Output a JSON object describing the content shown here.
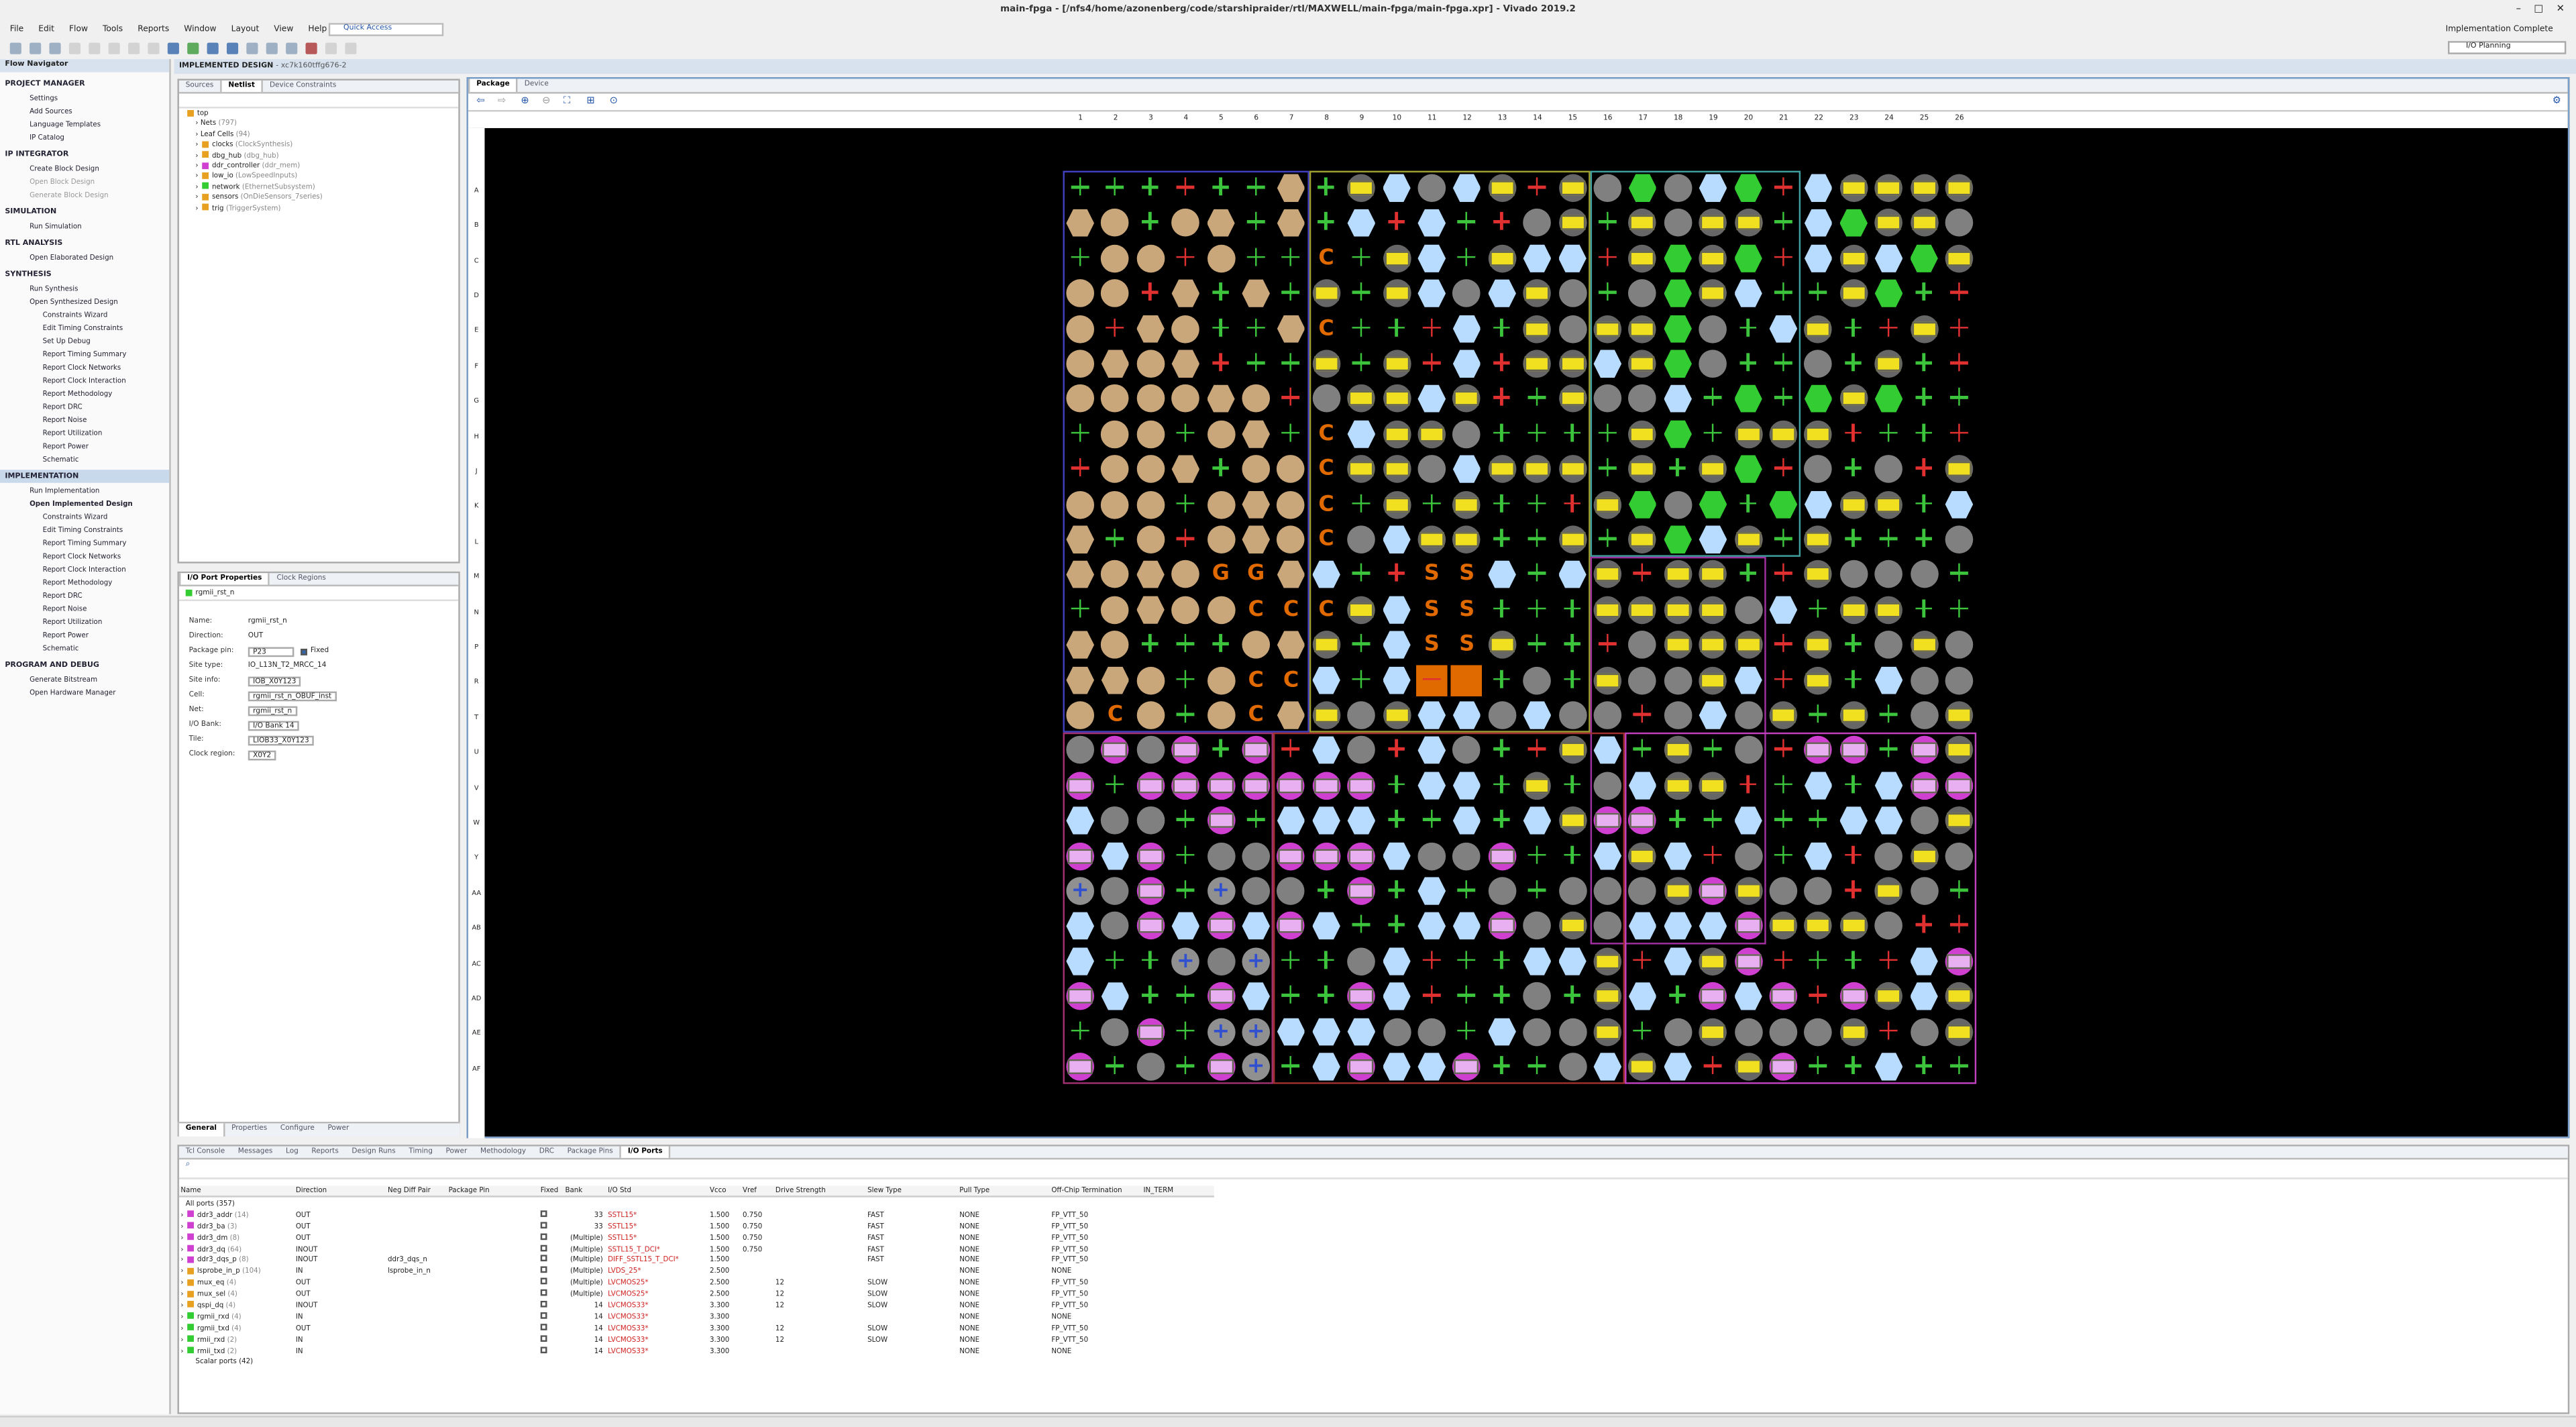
{
  "window": {
    "title": "main-fpga - [/nfs4/home/azonenberg/code/starshipraider/rtl/MAXWELL/main-fpga/main-fpga.xpr] - Vivado 2019.2"
  },
  "menu": [
    "File",
    "Edit",
    "Flow",
    "Tools",
    "Reports",
    "Window",
    "Layout",
    "View",
    "Help"
  ],
  "quick_access": "Quick Access",
  "status": {
    "implementation": "Implementation Complete",
    "layout": "I/O Planning"
  },
  "flow_navigator": {
    "title": "Flow Navigator",
    "project_manager": {
      "header": "PROJECT MANAGER",
      "items": [
        "Settings",
        "Add Sources",
        "Language Templates",
        "IP Catalog"
      ]
    },
    "ip_integrator": {
      "header": "IP INTEGRATOR",
      "items": [
        "Create Block Design",
        "Open Block Design",
        "Generate Block Design"
      ]
    },
    "simulation": {
      "header": "SIMULATION",
      "items": [
        "Run Simulation"
      ]
    },
    "rtl_analysis": {
      "header": "RTL ANALYSIS",
      "items": [
        "Open Elaborated Design"
      ]
    },
    "synthesis": {
      "header": "SYNTHESIS",
      "items": [
        "Run Synthesis",
        "Open Synthesized Design",
        "Constraints Wizard",
        "Edit Timing Constraints",
        "Set Up Debug",
        "Report Timing Summary",
        "Report Clock Networks",
        "Report Clock Interaction",
        "Report Methodology",
        "Report DRC",
        "Report Noise",
        "Report Utilization",
        "Report Power",
        "Schematic"
      ]
    },
    "implementation": {
      "header": "IMPLEMENTATION",
      "items": [
        "Run Implementation",
        "Open Implemented Design",
        "Constraints Wizard",
        "Edit Timing Constraints",
        "Report Timing Summary",
        "Report Clock Networks",
        "Report Clock Interaction",
        "Report Methodology",
        "Report DRC",
        "Report Noise",
        "Report Utilization",
        "Report Power",
        "Schematic"
      ]
    },
    "program_debug": {
      "header": "PROGRAM AND DEBUG",
      "items": [
        "Generate Bitstream",
        "Open Hardware Manager"
      ]
    }
  },
  "design_header": {
    "label": "IMPLEMENTED DESIGN",
    "part": "- xc7k160tffg676-2"
  },
  "netlist": {
    "tabs": [
      "Sources",
      "Netlist",
      "Device Constraints"
    ],
    "root": "top",
    "items": [
      {
        "name": "Nets",
        "sub": "(797)"
      },
      {
        "name": "Leaf Cells",
        "sub": "(94)"
      },
      {
        "name": "clocks",
        "sub": "(ClockSynthesis)"
      },
      {
        "name": "dbg_hub",
        "sub": "(dbg_hub)"
      },
      {
        "name": "ddr_controller",
        "sub": "(ddr_mem)"
      },
      {
        "name": "low_io",
        "sub": "(LowSpeedInputs)"
      },
      {
        "name": "network",
        "sub": "(EthernetSubsystem)"
      },
      {
        "name": "sensors",
        "sub": "(OnDieSensors_7series)"
      },
      {
        "name": "trig",
        "sub": "(TriggerSystem)"
      }
    ]
  },
  "properties": {
    "tabs": [
      "I/O Port Properties",
      "Clock Regions"
    ],
    "selected": "rgmii_rst_n",
    "rows": [
      {
        "k": "Name:",
        "v": "rgmii_rst_n"
      },
      {
        "k": "Direction:",
        "v": "OUT"
      },
      {
        "k": "Package pin:",
        "v": "P23",
        "fixed": "Fixed"
      },
      {
        "k": "Site type:",
        "v": "IO_L13N_T2_MRCC_14"
      },
      {
        "k": "Site info:",
        "v": "IOB_X0Y123"
      },
      {
        "k": "Cell:",
        "v": "rgmii_rst_n_OBUF_inst"
      },
      {
        "k": "Net:",
        "v": "rgmii_rst_n"
      },
      {
        "k": "I/O Bank:",
        "v": "I/O Bank 14"
      },
      {
        "k": "Tile:",
        "v": "LIOB33_X0Y123"
      },
      {
        "k": "Clock region:",
        "v": "X0Y2"
      }
    ],
    "bottom_tabs": [
      "General",
      "Properties",
      "Configure",
      "Power"
    ]
  },
  "package": {
    "tabs": [
      "Package",
      "Device"
    ],
    "columns": [
      "1",
      "2",
      "3",
      "4",
      "5",
      "6",
      "7",
      "8",
      "9",
      "10",
      "11",
      "12",
      "13",
      "14",
      "15",
      "16",
      "17",
      "18",
      "19",
      "20",
      "21",
      "22",
      "23",
      "24",
      "25",
      "26"
    ],
    "rows": [
      "A",
      "B",
      "C",
      "D",
      "E",
      "F",
      "G",
      "H",
      "J",
      "K",
      "L",
      "M",
      "N",
      "P",
      "R",
      "T",
      "U",
      "V",
      "W",
      "Y",
      "AA",
      "AB",
      "AC",
      "AD",
      "AE",
      "AF"
    ],
    "pin_letters": {
      "G": "G",
      "C": "C",
      "S": "S"
    },
    "colors": {
      "io_yellow": "#f0e020",
      "bank_tan": "#c9a77a",
      "clock_orange": "#e06a00",
      "magenta": "#d040d0",
      "lightblue": "#b8dcff",
      "gray": "#808080",
      "green": "#33cc33",
      "blue": "#3050d0"
    }
  },
  "bottom": {
    "tabs": [
      "Tcl Console",
      "Messages",
      "Log",
      "Reports",
      "Design Runs",
      "Timing",
      "Power",
      "Methodology",
      "DRC",
      "Package Pins",
      "I/O Ports"
    ],
    "headers": [
      "Name",
      "Direction",
      "Neg Diff Pair",
      "Package Pin",
      "Fixed",
      "Bank",
      "I/O Std",
      "Vcco",
      "Vref",
      "Drive Strength",
      "Slew Type",
      "Pull Type",
      "Off-Chip Termination",
      "IN_TERM"
    ],
    "all_ports": "All ports (357)",
    "ports": [
      {
        "name": "ddr3_addr",
        "cnt": "(14)",
        "dir": "OUT",
        "neg": "",
        "bank": "33",
        "std": "SSTL15*",
        "vcco": "1.500",
        "vref": "0.750",
        "drive": "",
        "slew": "FAST",
        "pull": "NONE",
        "term": "FP_VTT_50"
      },
      {
        "name": "ddr3_ba",
        "cnt": "(3)",
        "dir": "OUT",
        "neg": "",
        "bank": "33",
        "std": "SSTL15*",
        "vcco": "1.500",
        "vref": "0.750",
        "drive": "",
        "slew": "FAST",
        "pull": "NONE",
        "term": "FP_VTT_50"
      },
      {
        "name": "ddr3_dm",
        "cnt": "(8)",
        "dir": "OUT",
        "neg": "",
        "bank": "(Multiple)",
        "std": "SSTL15*",
        "vcco": "1.500",
        "vref": "0.750",
        "drive": "",
        "slew": "FAST",
        "pull": "NONE",
        "term": "FP_VTT_50"
      },
      {
        "name": "ddr3_dq",
        "cnt": "(64)",
        "dir": "INOUT",
        "neg": "",
        "bank": "(Multiple)",
        "std": "SSTL15_T_DCI*",
        "vcco": "1.500",
        "vref": "0.750",
        "drive": "",
        "slew": "FAST",
        "pull": "NONE",
        "term": "FP_VTT_50"
      },
      {
        "name": "ddr3_dqs_p",
        "cnt": "(8)",
        "dir": "INOUT",
        "neg": "ddr3_dqs_n",
        "bank": "(Multiple)",
        "std": "DIFF_SSTL15_T_DCI*",
        "vcco": "1.500",
        "vref": "",
        "drive": "",
        "slew": "FAST",
        "pull": "NONE",
        "term": "FP_VTT_50"
      },
      {
        "name": "lsprobe_in_p",
        "cnt": "(104)",
        "dir": "IN",
        "neg": "lsprobe_in_n",
        "bank": "(Multiple)",
        "std": "LVDS_25*",
        "vcco": "2.500",
        "vref": "",
        "drive": "",
        "slew": "",
        "pull": "NONE",
        "term": "NONE"
      },
      {
        "name": "mux_eq",
        "cnt": "(4)",
        "dir": "OUT",
        "neg": "",
        "bank": "(Multiple)",
        "std": "LVCMOS25*",
        "vcco": "2.500",
        "vref": "",
        "drive": "12",
        "slew": "SLOW",
        "pull": "NONE",
        "term": "FP_VTT_50"
      },
      {
        "name": "mux_sel",
        "cnt": "(4)",
        "dir": "OUT",
        "neg": "",
        "bank": "(Multiple)",
        "std": "LVCMOS25*",
        "vcco": "2.500",
        "vref": "",
        "drive": "12",
        "slew": "SLOW",
        "pull": "NONE",
        "term": "FP_VTT_50"
      },
      {
        "name": "qspi_dq",
        "cnt": "(4)",
        "dir": "INOUT",
        "neg": "",
        "bank": "14",
        "std": "LVCMOS33*",
        "vcco": "3.300",
        "vref": "",
        "drive": "12",
        "slew": "SLOW",
        "pull": "NONE",
        "term": "FP_VTT_50"
      },
      {
        "name": "rgmii_rxd",
        "cnt": "(4)",
        "dir": "IN",
        "neg": "",
        "bank": "14",
        "std": "LVCMOS33*",
        "vcco": "3.300",
        "vref": "",
        "drive": "",
        "slew": "",
        "pull": "NONE",
        "term": "NONE"
      },
      {
        "name": "rgmii_txd",
        "cnt": "(4)",
        "dir": "OUT",
        "neg": "",
        "bank": "14",
        "std": "LVCMOS33*",
        "vcco": "3.300",
        "vref": "",
        "drive": "12",
        "slew": "SLOW",
        "pull": "NONE",
        "term": "FP_VTT_50"
      },
      {
        "name": "rmii_rxd",
        "cnt": "(2)",
        "dir": "IN",
        "neg": "",
        "bank": "14",
        "std": "LVCMOS33*",
        "vcco": "3.300",
        "vref": "",
        "drive": "12",
        "slew": "SLOW",
        "pull": "NONE",
        "term": "FP_VTT_50"
      },
      {
        "name": "rmii_txd",
        "cnt": "(2)",
        "dir": "IN",
        "neg": "",
        "bank": "14",
        "std": "LVCMOS33*",
        "vcco": "3.300",
        "vref": "",
        "drive": "",
        "slew": "",
        "pull": "NONE",
        "term": "NONE"
      }
    ],
    "scalar_ports": "Scalar ports (42)"
  }
}
